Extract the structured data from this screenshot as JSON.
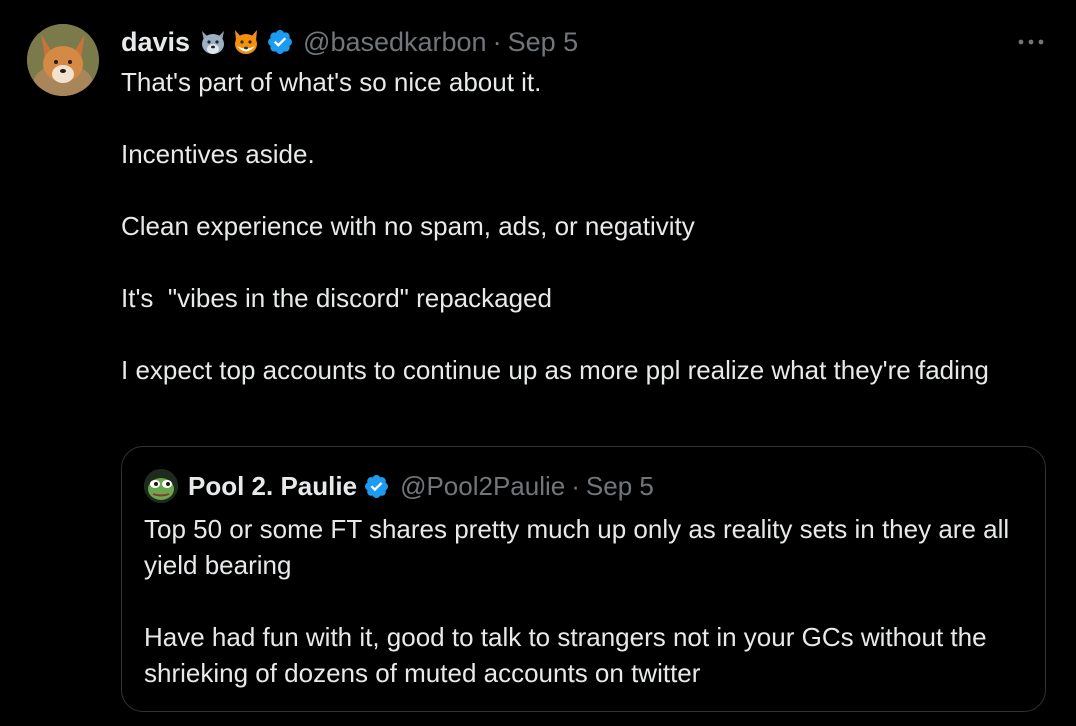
{
  "tweet": {
    "author": {
      "display_name": "davis",
      "emojis": [
        "wolf-emoji",
        "fox-emoji"
      ],
      "verified": true,
      "handle": "@basedkarbon",
      "separator": "·",
      "date": "Sep 5"
    },
    "more_icon": "more-icon",
    "paragraphs": [
      "That's part of what's so nice about it.",
      "Incentives aside.",
      "Clean experience with no spam, ads, or negativity",
      "It's  \"vibes in the discord\" repackaged",
      "I expect top accounts to continue up as more ppl realize what they're fading"
    ],
    "quote": {
      "display_name": "Pool 2. Paulie",
      "verified": true,
      "handle": "@Pool2Paulie",
      "separator": "·",
      "date": "Sep 5",
      "paragraphs": [
        "Top 50 or some FT shares pretty much up only as reality sets in they are all yield bearing",
        "Have had fun with it, good to talk to strangers not in your GCs without the shrieking of dozens of muted accounts on twitter"
      ]
    },
    "colors": {
      "background": "#000000",
      "text": "#e7e9ea",
      "secondary": "#71767b",
      "verified": "#1d9bf0",
      "border": "#2f3336"
    }
  }
}
